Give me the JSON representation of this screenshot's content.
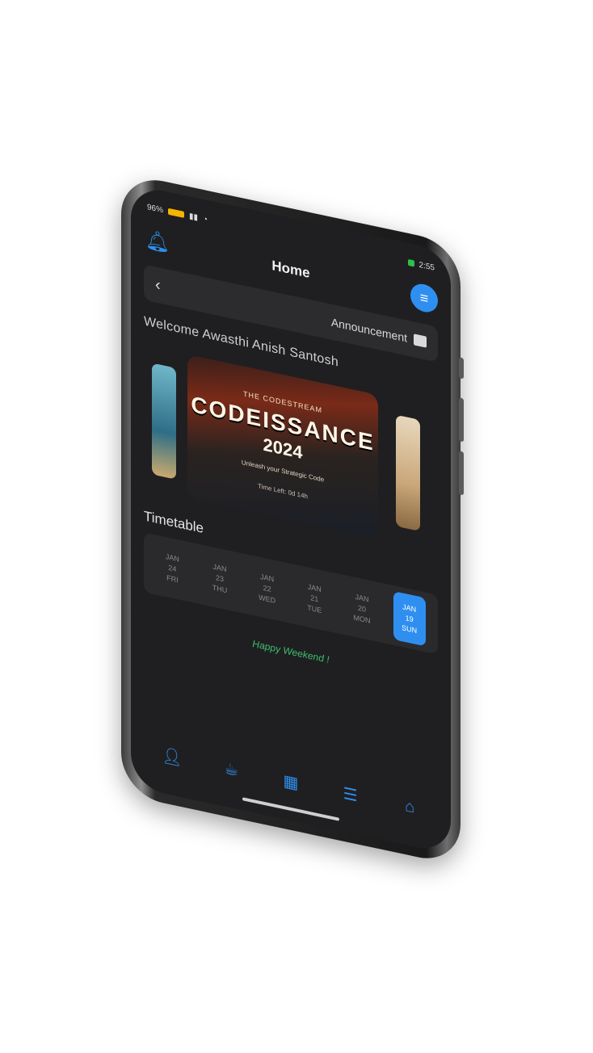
{
  "status_bar": {
    "battery_pct": "96%",
    "time": "2:55"
  },
  "header": {
    "title": "Home"
  },
  "announcement": {
    "label": "Announcement"
  },
  "welcome": "Welcome Awasthi Anish Santosh",
  "poster": {
    "top": "THE CODESTREAM",
    "name": "CODEISSANCE",
    "year": "2024",
    "sub": "Unleash your Strategic Code",
    "foot": "Time Left: 0d 14h"
  },
  "timetable": {
    "title": "Timetable",
    "dates": [
      {
        "month": "JAN",
        "day": "19",
        "dow": "SUN",
        "active": true
      },
      {
        "month": "JAN",
        "day": "20",
        "dow": "MON",
        "active": false
      },
      {
        "month": "JAN",
        "day": "21",
        "dow": "TUE",
        "active": false
      },
      {
        "month": "JAN",
        "day": "22",
        "dow": "WED",
        "active": false
      },
      {
        "month": "JAN",
        "day": "23",
        "dow": "THU",
        "active": false
      },
      {
        "month": "JAN",
        "day": "24",
        "dow": "FRI",
        "active": false
      }
    ],
    "message": "Happy Weekend !"
  },
  "nav": {
    "icons": [
      "home-icon",
      "list-icon",
      "calendar-icon",
      "cup-icon",
      "profile-icon"
    ]
  },
  "colors": {
    "accent": "#2f8ff0",
    "background": "#1f1f21",
    "weekend": "#3fbf70"
  }
}
